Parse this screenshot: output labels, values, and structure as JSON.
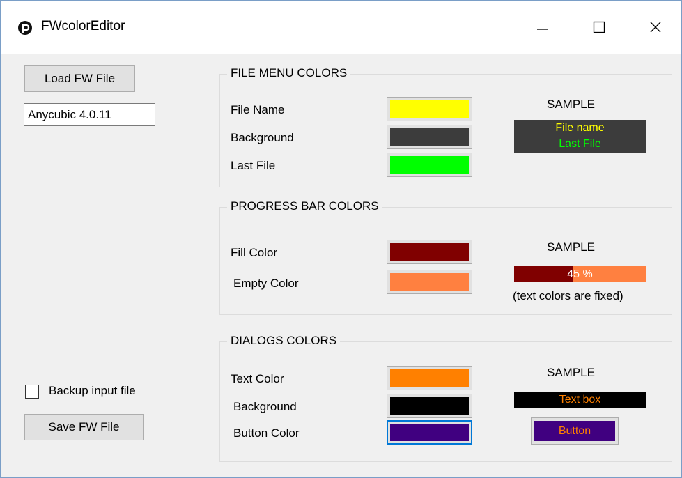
{
  "window": {
    "title": "FWcolorEditor",
    "controls": {
      "minimize": "minimize-icon",
      "maximize": "maximize-icon",
      "close": "close-icon"
    }
  },
  "left_panel": {
    "load_button": "Load FW File",
    "firmware_version": "Anycubic 4.0.11",
    "backup_checkbox_label": "Backup input file",
    "backup_checked": false,
    "save_button": "Save FW File"
  },
  "file_menu": {
    "title": "FILE MENU COLORS",
    "labels": {
      "file_name": "File Name",
      "background": "Background",
      "last_file": "Last File"
    },
    "colors": {
      "file_name": "#ffff00",
      "background": "#3c3c3c",
      "last_file": "#00ff00"
    },
    "sample": {
      "title": "SAMPLE",
      "file_name_text": "File name",
      "last_file_text": "Last File"
    }
  },
  "progress_bar": {
    "title": "PROGRESS BAR COLORS",
    "labels": {
      "fill": "Fill Color",
      "empty": "Empty Color"
    },
    "colors": {
      "fill": "#800000",
      "empty": "#ff8040"
    },
    "sample": {
      "title": "SAMPLE",
      "percent_text": "45 %",
      "progress": 0.45,
      "note": "(text colors are fixed)"
    }
  },
  "dialogs": {
    "title": "DIALOGS COLORS",
    "labels": {
      "text": "Text Color",
      "background": "Background",
      "button": "Button Color"
    },
    "colors": {
      "text": "#ff8000",
      "background": "#000000",
      "button": "#400080"
    },
    "sample": {
      "title": "SAMPLE",
      "textbox_text": "Text box",
      "button_text": "Button"
    }
  }
}
